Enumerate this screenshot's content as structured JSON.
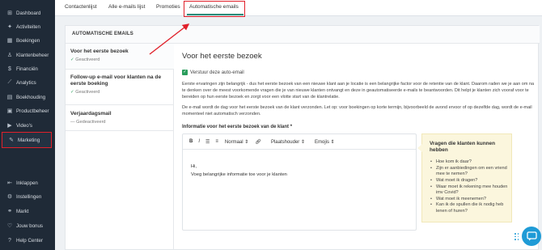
{
  "sidebar": {
    "items": [
      {
        "label": "Dashboard",
        "icon": "dashboard-icon"
      },
      {
        "label": "Activiteiten",
        "icon": "activity-icon"
      },
      {
        "label": "Boekingen",
        "icon": "calendar-icon"
      },
      {
        "label": "Klantenbeheer",
        "icon": "user-icon"
      },
      {
        "label": "Financiën",
        "icon": "money-icon"
      },
      {
        "label": "Analytics",
        "icon": "chart-icon"
      },
      {
        "label": "Boekhouding",
        "icon": "book-icon"
      },
      {
        "label": "Productbeheer",
        "icon": "box-icon"
      },
      {
        "label": "Video's",
        "icon": "video-icon"
      },
      {
        "label": "Marketing",
        "icon": "megaphone-icon"
      }
    ],
    "bottom_items": [
      {
        "label": "Inklappen",
        "icon": "collapse-icon"
      },
      {
        "label": "Instellingen",
        "icon": "gear-icon"
      },
      {
        "label": "Markt",
        "icon": "share-icon"
      },
      {
        "label": "Jouw bonus",
        "icon": "heart-icon"
      },
      {
        "label": "Help Center",
        "icon": "help-icon"
      }
    ]
  },
  "tabs": [
    "Contactenlijst",
    "Alle e-mails lijst",
    "Promoties",
    "Automatische emails"
  ],
  "active_tab": "Automatische emails",
  "card": {
    "header": "AUTOMATISCHE EMAILS",
    "list": [
      {
        "title": "Voor het eerste bezoek",
        "status": "Geactiveerd",
        "state": "on"
      },
      {
        "title": "Follow-up e-mail voor klanten na de eerste boeking",
        "status": "Geactiveerd",
        "state": "on"
      },
      {
        "title": "Verjaardagsmail",
        "status": "Gedeactiveerd",
        "state": "off"
      }
    ]
  },
  "detail": {
    "title": "Voor het eerste bezoek",
    "checkbox_label": "Verstuur deze auto-email",
    "para1": "Eerste ervaringen zijn belangrijk - dus het eerste bezoek van een nieuwe klant aan je locatie is een belangrijke factor voor de retentie van de klant. Daarom raden we je aan om na te denken over de meest voorkomende vragen die je van nieuwe klanten ontvangt en deze in geautomatiseerde e-mails te beantwoorden. Dit helpt je klanten zich vooraf voor te bereiden op hun eerste bezoek en zorgt voor een vlotte start van de klantrelatie.",
    "para2": "De e-mail wordt de dag voor het eerste bezoek van de klant verzonden. Let op: voor boekingen op korte termijn, bijvoorbeeld de avond ervoor of op dezelfde dag, wordt de e-mail momenteel niet automatisch verzonden.",
    "field_label": "Informatie voor het eerste bezoek van de klant *",
    "toolbar": {
      "bold": "B",
      "italic": "I",
      "format": "Normaal",
      "placeholder": "Plaatshouder",
      "emoji": "Emojis"
    },
    "body_line1": "Hi,",
    "body_line2": "Voeg belangrijke informatie toe voor je klanten"
  },
  "tips": {
    "heading": "Vragen die klanten kunnen hebben",
    "items": [
      "Hoe kom ik daar?",
      "Zijn er aanbiedingen om een vriend mee te nemen?",
      "Wat moet ik dragen?",
      "Waar moet ik rekening mee houden imv Covid?",
      "Wat moet ik meenemen?",
      "Kan ik de spullen die ik nodig heb lenen of huren?"
    ]
  },
  "colors": {
    "sidebar": "#1f2a37",
    "accent": "#2a8c7a",
    "highlight": "#e0202a",
    "chat": "#1f9bd6"
  }
}
